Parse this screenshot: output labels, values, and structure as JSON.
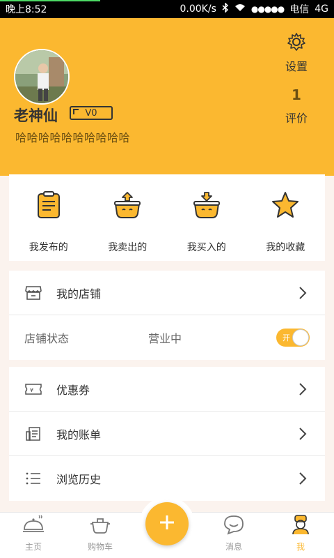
{
  "status_bar": {
    "time": "晚上8:52",
    "network_speed": "0.00K/s",
    "carrier": "电信",
    "network": "4G"
  },
  "profile": {
    "name": "老神仙",
    "vip_level": "V0",
    "bio": "哈哈哈哈哈哈哈哈哈哈",
    "settings_label": "设置",
    "rating_count": "1",
    "rating_label": "评价"
  },
  "quick_actions": [
    {
      "label": "我发布的",
      "icon": "published-icon"
    },
    {
      "label": "我卖出的",
      "icon": "sold-icon"
    },
    {
      "label": "我买入的",
      "icon": "bought-icon"
    },
    {
      "label": "我的收藏",
      "icon": "star-icon"
    }
  ],
  "shop": {
    "label": "我的店铺",
    "status_label": "店铺状态",
    "status_value": "营业中",
    "toggle_text": "开",
    "toggle_on": true
  },
  "menu": [
    {
      "label": "优惠券",
      "icon": "coupon-icon"
    },
    {
      "label": "我的账单",
      "icon": "bill-icon"
    },
    {
      "label": "浏览历史",
      "icon": "history-icon"
    }
  ],
  "nav": {
    "home": "主页",
    "cart": "购物车",
    "messages": "消息",
    "me": "我",
    "active": "me"
  },
  "colors": {
    "accent": "#fbb830",
    "background": "#fbf3ee"
  }
}
